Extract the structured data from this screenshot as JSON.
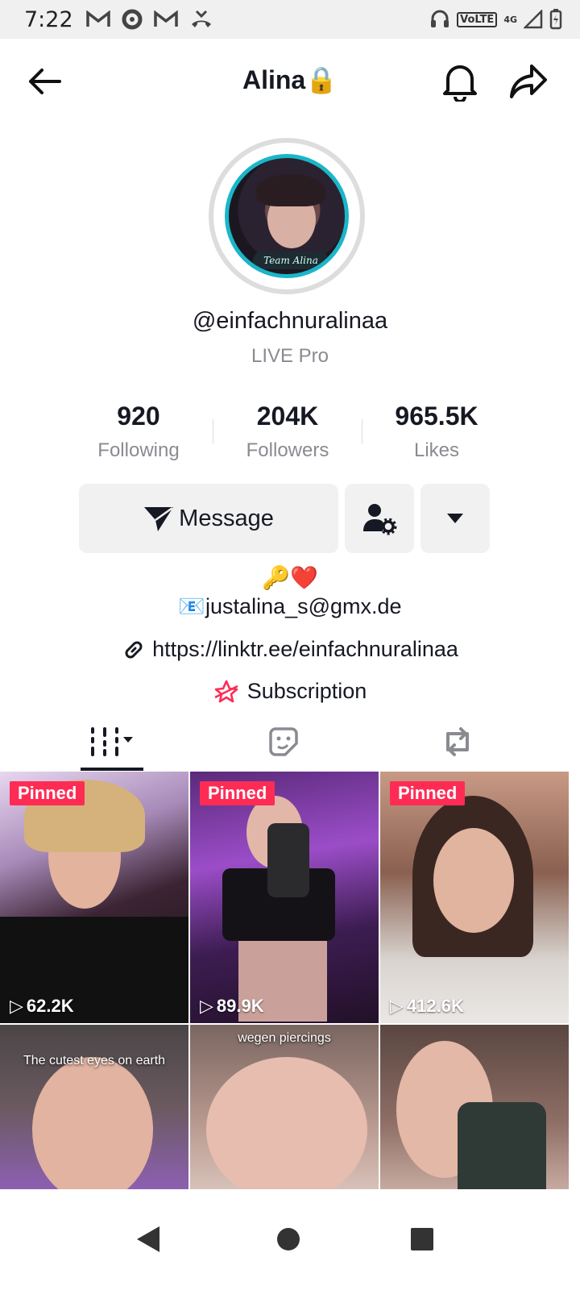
{
  "status_bar": {
    "time": "7:22",
    "left_icons": [
      "gmail-icon",
      "sync-icon",
      "gmail-icon",
      "missed-call-icon"
    ],
    "volte": "VoLTE",
    "network": "4G"
  },
  "header": {
    "title": "Alina⁣🔒"
  },
  "profile": {
    "username": "@einfachnuralinaa",
    "subtitle": "LIVE Pro",
    "avatar_badge": "Team Alina"
  },
  "stats": [
    {
      "value": "920",
      "label": "Following"
    },
    {
      "value": "204K",
      "label": "Followers"
    },
    {
      "value": "965.5K",
      "label": "Likes"
    }
  ],
  "buttons": {
    "message": "Message"
  },
  "bio": {
    "emoji_line": "🔑❤️",
    "email_line": "📧justalina_s@gmx.de",
    "link": "https://linktr.ee/einfachnuralinaa",
    "subscription": "Subscription"
  },
  "videos": [
    {
      "pinned_label": "Pinned",
      "views": "62.2K"
    },
    {
      "pinned_label": "Pinned",
      "views": "89.9K"
    },
    {
      "pinned_label": "Pinned",
      "views": "412.6K"
    },
    {
      "caption": "The cutest eyes on earth"
    },
    {
      "caption": "wegen piercings"
    },
    {
      "caption": ""
    }
  ],
  "colors": {
    "accent": "#fe2c55",
    "avatar_ring": "#1ab6c8"
  }
}
